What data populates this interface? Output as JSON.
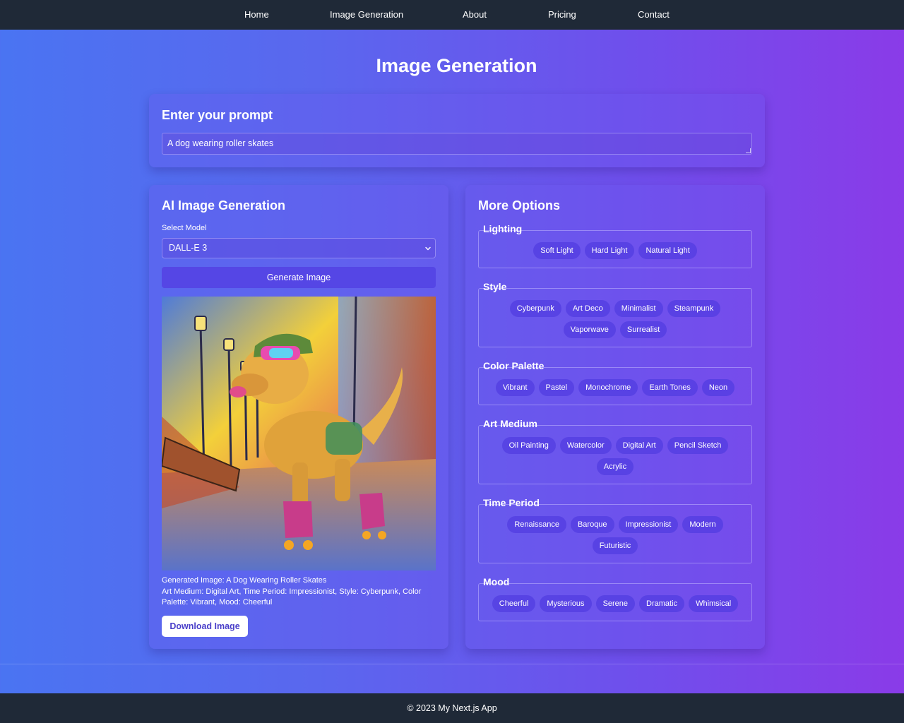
{
  "nav": {
    "items": [
      "Home",
      "Image Generation",
      "About",
      "Pricing",
      "Contact"
    ]
  },
  "page": {
    "title": "Image Generation"
  },
  "prompt_card": {
    "title": "Enter your prompt",
    "value": "A dog wearing roller skates"
  },
  "generation_card": {
    "title": "AI Image Generation",
    "model_label": "Select Model",
    "model_selected": "DALL-E 3",
    "generate_label": "Generate Image",
    "caption_line1": "Generated Image: A Dog Wearing Roller Skates",
    "caption_line2": "Art Medium: Digital Art, Time Period: Impressionist, Style: Cyberpunk, Color Palette: Vibrant, Mood: Cheerful",
    "download_label": "Download Image"
  },
  "options_card": {
    "title": "More Options",
    "groups": [
      {
        "title": "Lighting",
        "chips": [
          "Soft Light",
          "Hard Light",
          "Natural Light"
        ]
      },
      {
        "title": "Style",
        "chips": [
          "Cyberpunk",
          "Art Deco",
          "Minimalist",
          "Steampunk",
          "Vaporwave",
          "Surrealist"
        ]
      },
      {
        "title": "Color Palette",
        "chips": [
          "Vibrant",
          "Pastel",
          "Monochrome",
          "Earth Tones",
          "Neon"
        ]
      },
      {
        "title": "Art Medium",
        "chips": [
          "Oil Painting",
          "Watercolor",
          "Digital Art",
          "Pencil Sketch",
          "Acrylic"
        ]
      },
      {
        "title": "Time Period",
        "chips": [
          "Renaissance",
          "Baroque",
          "Impressionist",
          "Modern",
          "Futuristic"
        ]
      },
      {
        "title": "Mood",
        "chips": [
          "Cheerful",
          "Mysterious",
          "Serene",
          "Dramatic",
          "Whimsical"
        ]
      }
    ]
  },
  "footer": {
    "text": "© 2023 My Next.js App"
  },
  "colors": {
    "nav_bg": "#1f2937",
    "gradient_start": "#4a74f2",
    "gradient_end": "#8a3be8",
    "button_bg": "#5546e5",
    "chip_bg": "#5a44e0"
  },
  "icons": {
    "select": "chevron-down-icon",
    "textarea": "resize-grip-icon"
  }
}
